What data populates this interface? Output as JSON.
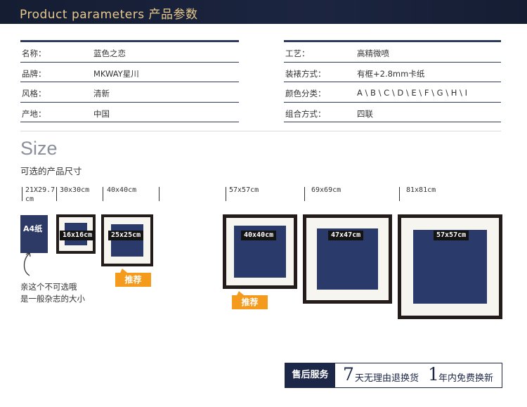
{
  "header": {
    "title": "Product parameters 产品参数"
  },
  "params_left": [
    {
      "key": "名称：",
      "value": "蓝色之恋"
    },
    {
      "key": "品牌：",
      "value": "MKWAY星川"
    },
    {
      "key": "风格：",
      "value": "清新"
    },
    {
      "key": "产地：",
      "value": "中国"
    }
  ],
  "params_right": [
    {
      "key": "工艺：",
      "value": "高精微喷"
    },
    {
      "key": "装裱方式：",
      "value": "有框+2.8mm卡纸"
    },
    {
      "key": "颜色分类：",
      "value": "A \\ B \\ C \\ D \\ E \\ F \\ G \\ H \\ I"
    },
    {
      "key": "组合方式：",
      "value": "四联"
    }
  ],
  "size_section": {
    "title": "Size",
    "subtitle": "可选的产品尺寸",
    "size_labels": [
      "21X29.7 cm",
      "30x30cm",
      "40x40cm",
      "57x57cm",
      "69x69cm",
      "81x81cm"
    ],
    "a4_label": "A4纸",
    "note_line1": "亲这个不可选哦",
    "note_line2": "是一般杂志的大小",
    "frames": [
      {
        "outer": "30x30cm",
        "inner_label": "16x16cm",
        "recommended": false
      },
      {
        "outer": "40x40cm",
        "inner_label": "25x25cm",
        "recommended": true
      },
      {
        "outer": "57x57cm",
        "inner_label": "40x40cm",
        "recommended": true
      },
      {
        "outer": "69x69cm",
        "inner_label": "47x47cm",
        "recommended": false
      },
      {
        "outer": "81x81cm",
        "inner_label": "57x57cm",
        "recommended": false
      }
    ],
    "recommend_label": "推荐"
  },
  "service": {
    "label": "售后服务",
    "num1": "7",
    "text1": "天无理由退换货",
    "num2": "1",
    "text2": "年内免费换新"
  },
  "colors": {
    "navy": "#1d2748",
    "art_blue": "#2a3a6a",
    "frame": "#231c1a",
    "accent_orange": "#f49a1c",
    "header_gold": "#e8c98a"
  }
}
